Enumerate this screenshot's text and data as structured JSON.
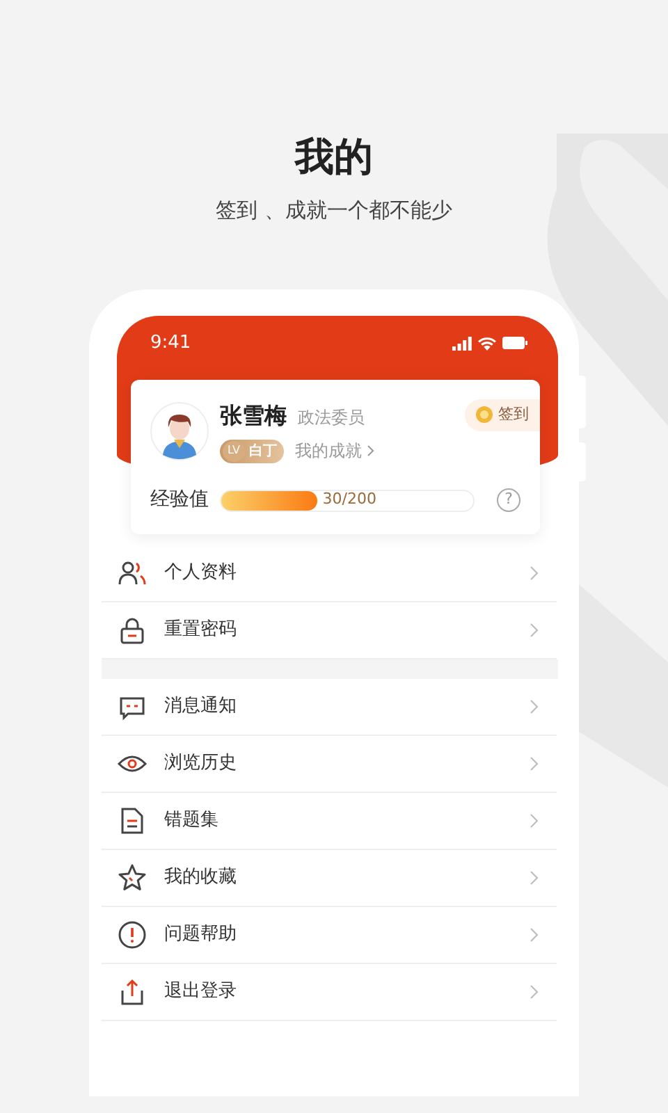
{
  "headline": {
    "title": "我的",
    "subtitle": "签到 、成就一个都不能少"
  },
  "status_bar": {
    "time": "9:41"
  },
  "profile": {
    "name": "张雪梅",
    "role": "政法委员",
    "level_prefix": "LV",
    "level_name": "白丁",
    "achievements": "我的成就",
    "checkin": "签到"
  },
  "experience": {
    "label": "经验值",
    "level": 0.38,
    "reading": "30/200",
    "help": "?"
  },
  "menu_groups": [
    [
      {
        "label": "个人资料"
      },
      {
        "label": "重置密码"
      }
    ],
    [
      {
        "label": "消息通知"
      },
      {
        "label": "浏览历史"
      },
      {
        "label": "错题集"
      },
      {
        "label": "我的收藏"
      },
      {
        "label": "问题帮助"
      },
      {
        "label": "退出登录"
      }
    ]
  ]
}
